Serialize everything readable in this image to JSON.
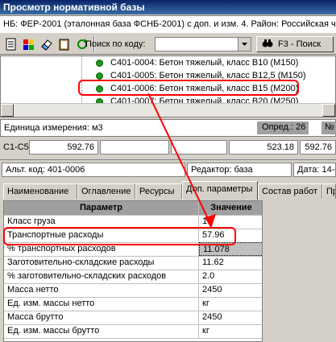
{
  "window": {
    "title": "Просмотр нормативной базы"
  },
  "infobar": {
    "text": "НБ: ФЕР-2001 (эталонная база ФСНБ-2001) с доп. и изм. 4. Район: Российская ч"
  },
  "toolbar": {
    "search_label": "Поиск по коду:",
    "search_value": "",
    "f3_label": "F3 - Поиск",
    "buttons": [
      "doc-icon",
      "palette-icon",
      "eraser-icon",
      "clipboard-icon",
      "refresh-icon"
    ]
  },
  "tree": {
    "items": [
      {
        "label": "С401-0004: Бетон тяжелый, класс В10 (М150)"
      },
      {
        "label": "С401-0005: Бетон тяжелый, класс В12,5 (М150)"
      },
      {
        "label": "С401-0006: Бетон тяжелый, класс В15 (М200)"
      },
      {
        "label": "С401-0007: Бетон тяжелый, класс В20 (М250)"
      }
    ]
  },
  "unit": {
    "label": "Единица измерения: м3",
    "opred_label": "Опред.: 26",
    "n_label": "№"
  },
  "prices": {
    "label": "С1-С5:",
    "v1": "592.76",
    "v2": "523.18",
    "v3": "592.76"
  },
  "alt": {
    "code_label": "Альт. код: 401-0006",
    "editor_label": "Редактор: база",
    "date_label": "Дата: 14-0"
  },
  "tabs": [
    {
      "label": "Наименование"
    },
    {
      "label": "Оглавление"
    },
    {
      "label": "Ресурсы"
    },
    {
      "label": "Доп. параметры"
    },
    {
      "label": "Состав работ"
    },
    {
      "label": "Пр"
    }
  ],
  "grid": {
    "col_param": "Параметр",
    "col_value": "Значение",
    "rows": [
      {
        "param": "Класс груза",
        "value": "1"
      },
      {
        "param": "Транспортные расходы",
        "value": "57.96"
      },
      {
        "param": "% транспортных расходов",
        "value": "11.078"
      },
      {
        "param": "Заготовительно-складские расходы",
        "value": "11.62"
      },
      {
        "param": "% заготовительно-складских расходов",
        "value": "2.0"
      },
      {
        "param": "Масса нетто",
        "value": "2450"
      },
      {
        "param": "Ед. изм. массы нетто",
        "value": "кг"
      },
      {
        "param": "Масса брутто",
        "value": "2450"
      },
      {
        "param": "Ед. изм. массы брутто",
        "value": "кг"
      }
    ]
  },
  "colors": {
    "highlight": "#ff0000",
    "title_bg": "#0a246a",
    "selected_cell": "#c0c0c0"
  }
}
